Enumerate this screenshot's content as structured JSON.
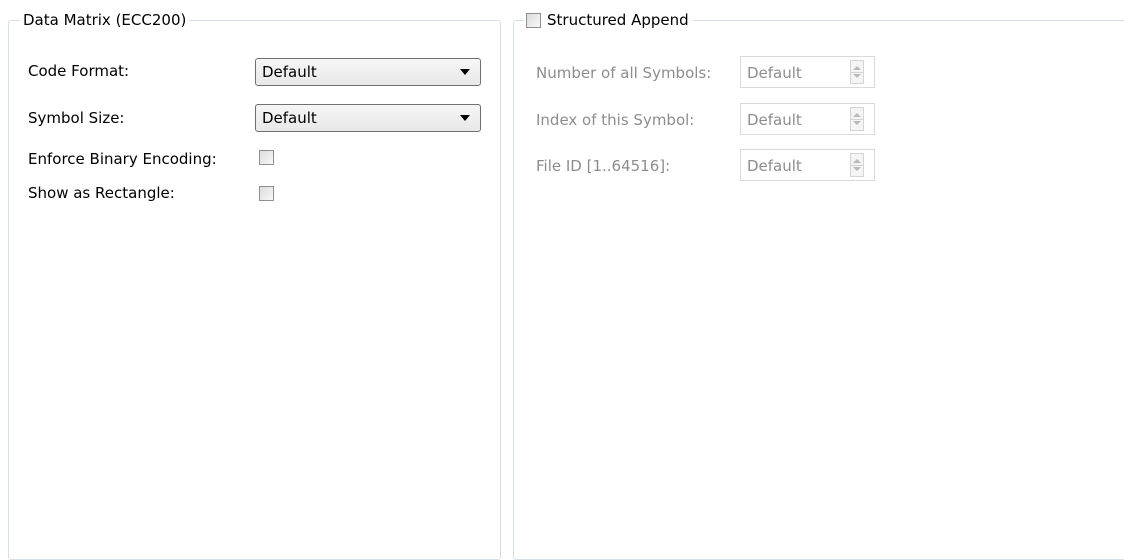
{
  "data_matrix": {
    "title": "Data Matrix (ECC200)",
    "code_format": {
      "label": "Code Format:",
      "value": "Default"
    },
    "symbol_size": {
      "label": "Symbol Size:",
      "value": "Default"
    },
    "enforce_binary": {
      "label": "Enforce Binary Encoding:",
      "checked": false
    },
    "show_rectangle": {
      "label": "Show as Rectangle:",
      "checked": false
    }
  },
  "structured_append": {
    "title": "Structured Append",
    "checked": false,
    "number_of_symbols": {
      "label": "Number of all Symbols:",
      "value": "Default"
    },
    "index_of_symbol": {
      "label": "Index of this Symbol:",
      "value": "Default"
    },
    "file_id": {
      "label": "File ID [1..64516]:",
      "value": "Default"
    }
  }
}
